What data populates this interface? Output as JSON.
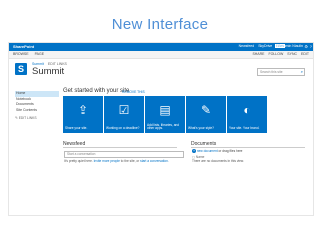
{
  "slide": {
    "title": "New Interface"
  },
  "suitebar": {
    "brand": "SharePoint",
    "links": [
      "Newsfeed",
      "SkyDrive",
      "Sites"
    ],
    "active_link": "Sites",
    "user": "Benjamin Niaulin",
    "gear_icon": "gear-icon",
    "help_icon": "help-icon"
  },
  "ribbon": {
    "tabs": [
      "BROWSE",
      "PAGE"
    ],
    "actions": [
      "SHARE",
      "FOLLOW",
      "SYNC",
      "EDIT"
    ]
  },
  "header": {
    "logo_letter": "S",
    "breadcrumb": {
      "link": "Summit",
      "edit": "EDIT LINKS"
    },
    "title": "Summit",
    "search_placeholder": "Search this site",
    "search_icon": "search-icon"
  },
  "leftnav": {
    "items": [
      "Home",
      "Notebook",
      "Documents",
      "Site Contents"
    ],
    "selected": "Home",
    "edit": "EDIT LINKS"
  },
  "getting_started": {
    "title": "Get started with your site",
    "remove": "REMOVE THIS",
    "tiles": [
      {
        "icon": "share-icon",
        "glyph": "⇪",
        "label": "Share your site."
      },
      {
        "icon": "checklist-icon",
        "glyph": "☑",
        "label": "Working on a deadline?"
      },
      {
        "icon": "apps-icon",
        "glyph": "▤",
        "label": "Add lists, libraries, and other apps."
      },
      {
        "icon": "brush-icon",
        "glyph": "✎",
        "label": "What's your style?"
      },
      {
        "icon": "brand-icon",
        "glyph": "◐",
        "label": "Your site. Your brand."
      }
    ]
  },
  "newsfeed": {
    "title": "Newsfeed",
    "placeholder": "Start a conversation",
    "message_pre": "It's pretty quiet here.",
    "message_link1": "Invite more people",
    "message_mid": "to the site, or",
    "message_link2": "start a conversation.",
    "message_end": ""
  },
  "documents": {
    "title": "Documents",
    "new_link": "new document",
    "new_suffix": "or drag files here",
    "column": "Name",
    "empty": "There are no documents in this view."
  }
}
